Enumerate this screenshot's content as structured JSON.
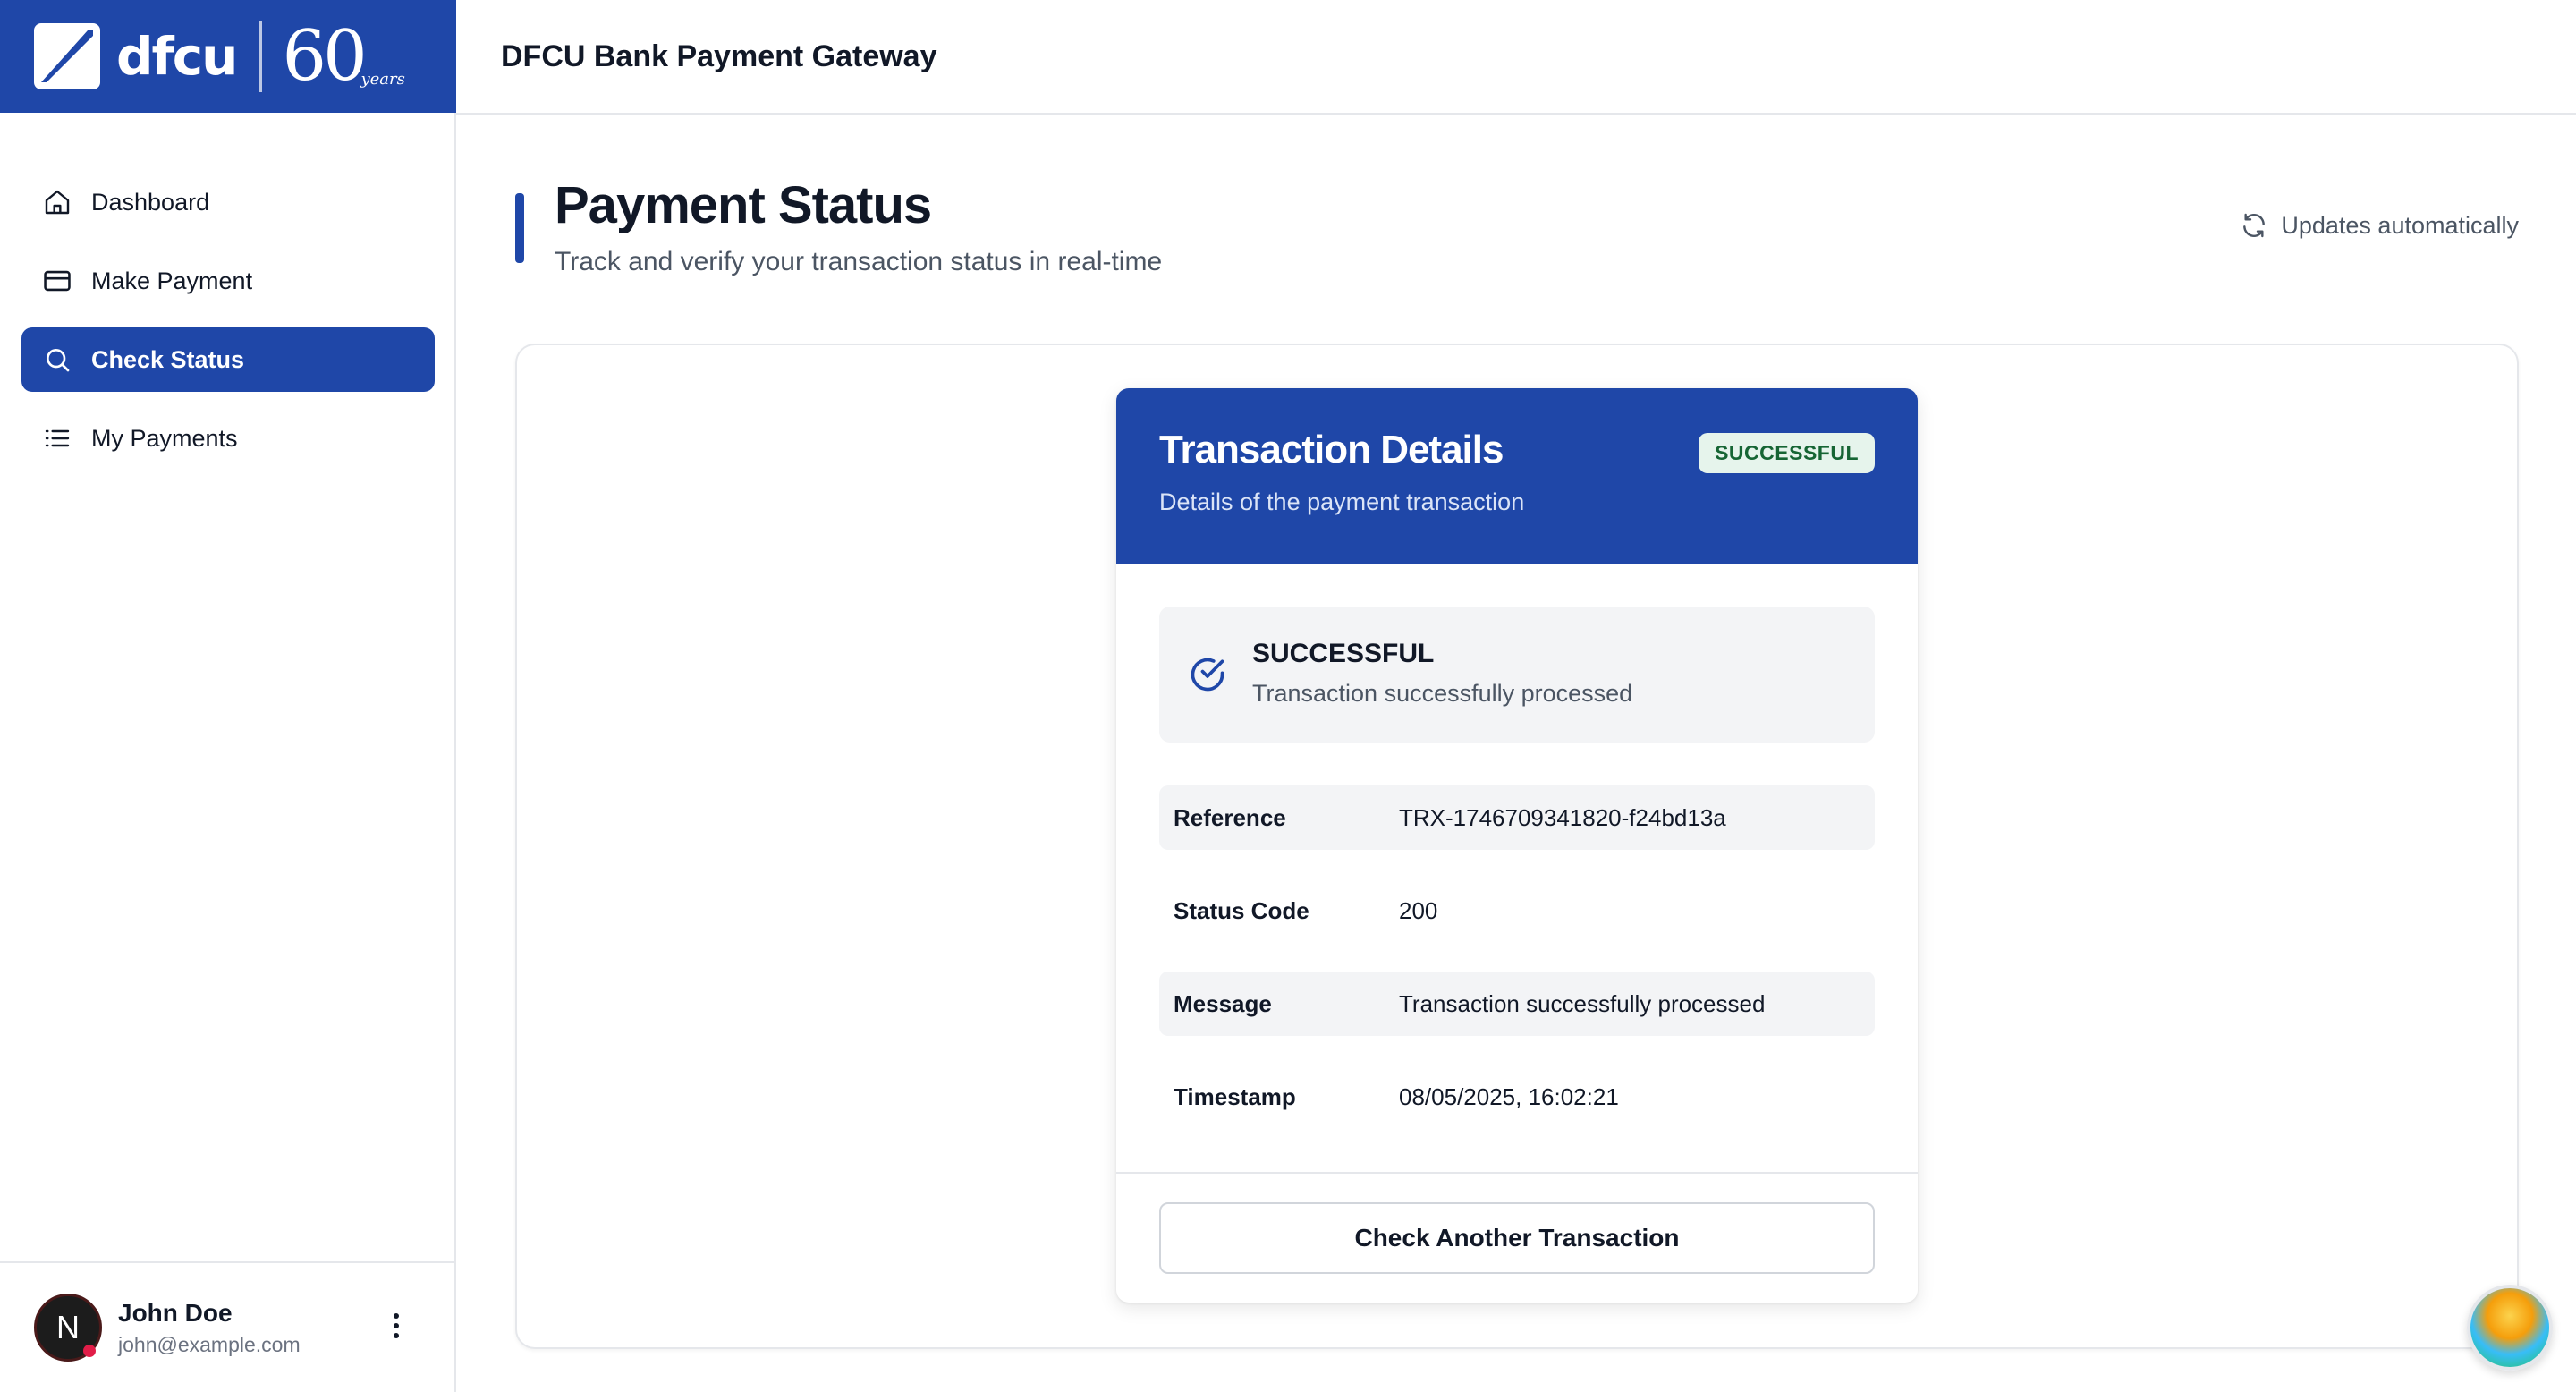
{
  "brand": {
    "name": "dfcu",
    "anniversary": "60",
    "anniversary_script": "years"
  },
  "header": {
    "title": "DFCU Bank Payment Gateway"
  },
  "sidebar": {
    "items": [
      {
        "label": "Dashboard",
        "icon": "home-icon",
        "active": false
      },
      {
        "label": "Make Payment",
        "icon": "credit-card-icon",
        "active": false
      },
      {
        "label": "Check Status",
        "icon": "search-icon",
        "active": true
      },
      {
        "label": "My Payments",
        "icon": "list-icon",
        "active": false
      }
    ]
  },
  "user": {
    "initial": "N",
    "name": "John Doe",
    "email": "john@example.com"
  },
  "page": {
    "title": "Payment Status",
    "subtitle": "Track and verify your transaction status in real-time",
    "auto_update": "Updates automatically"
  },
  "transaction": {
    "title": "Transaction Details",
    "subtitle": "Details of the payment transaction",
    "badge": "SUCCESSFUL",
    "status_title": "SUCCESSFUL",
    "status_message": "Transaction successfully processed",
    "rows": [
      {
        "label": "Reference",
        "value": "TRX-1746709341820-f24bd13a"
      },
      {
        "label": "Status Code",
        "value": "200"
      },
      {
        "label": "Message",
        "value": "Transaction successfully processed"
      },
      {
        "label": "Timestamp",
        "value": "08/05/2025, 16:02:21"
      }
    ],
    "button": "Check Another Transaction"
  },
  "colors": {
    "primary": "#1f47a8",
    "success_bg": "#e6f4ec",
    "success_text": "#166534"
  }
}
